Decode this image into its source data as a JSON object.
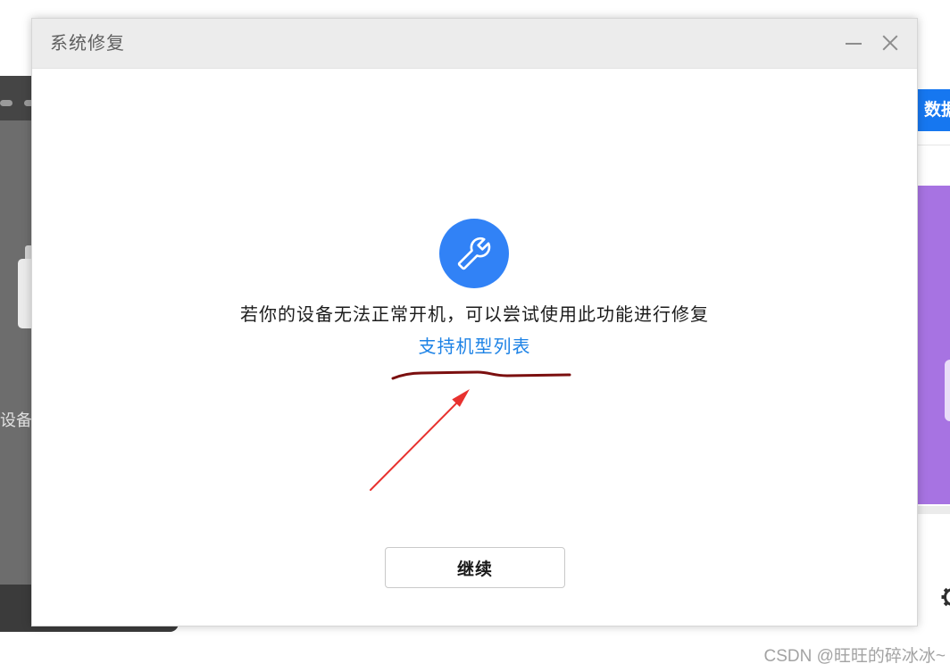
{
  "dialog": {
    "title": "系统修复",
    "message": "若你的设备无法正常开机，可以尝试使用此功能进行修复",
    "supported_models_link": "支持机型列表",
    "continue_label": "继续"
  },
  "background_app": {
    "device_label": "设备",
    "data_button_label": "数据"
  },
  "watermark": "CSDN @旺旺的碎冰冰~",
  "icons": {
    "title_minimize": "minimize-icon",
    "title_close": "close-icon",
    "repair": "wrench-icon",
    "settings": "gear-icon"
  },
  "colors": {
    "accent_blue": "#3182f6",
    "link_blue": "#1e83e6",
    "app_button_blue": "#1677f0",
    "purple_panel": "#a773e2",
    "annotation_red": "#e8322f",
    "annotation_dark_red": "#7b0f0f"
  }
}
